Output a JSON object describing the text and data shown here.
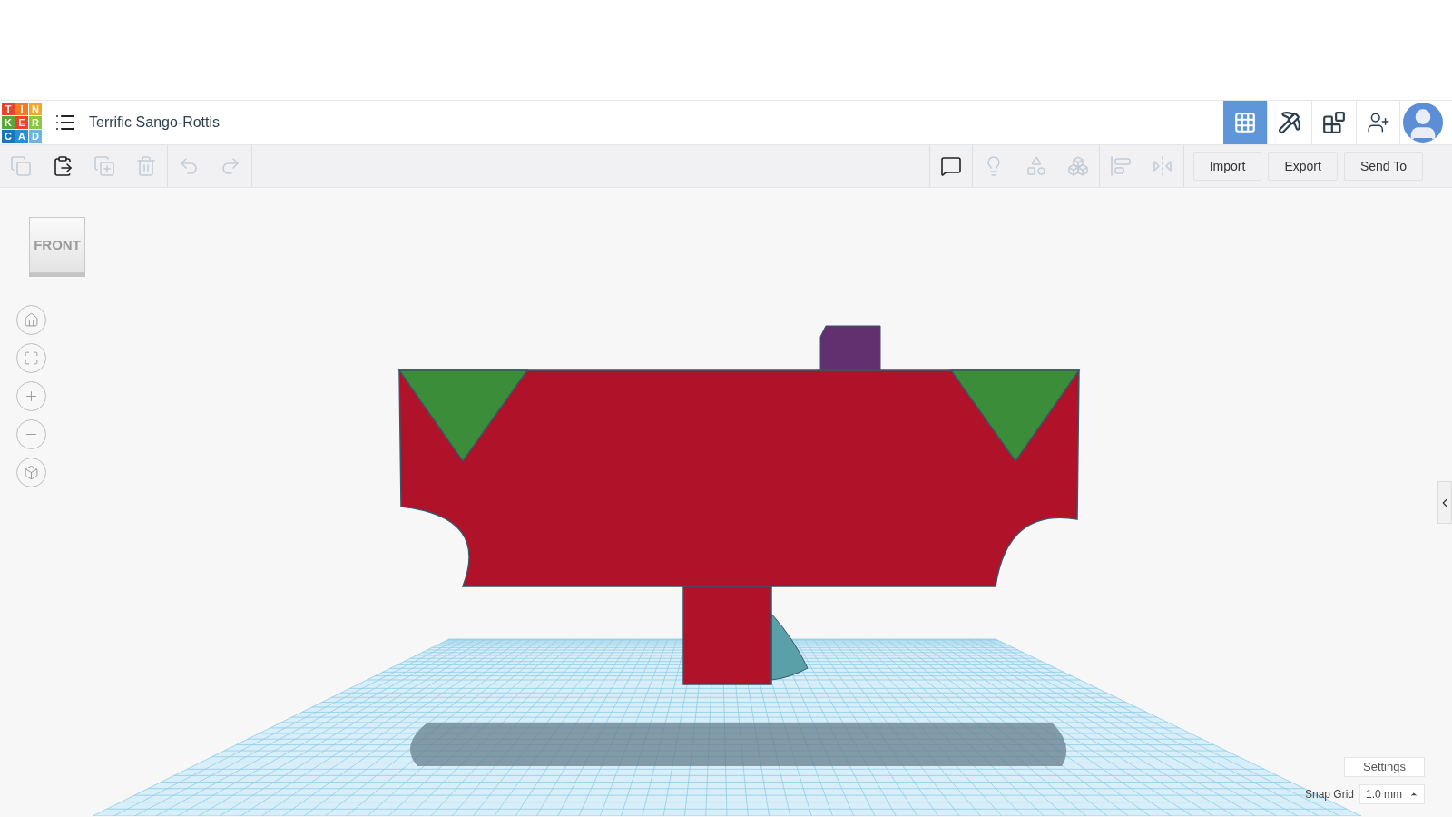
{
  "logo": [
    {
      "letter": "T",
      "color": "#e8452c"
    },
    {
      "letter": "I",
      "color": "#f47b20"
    },
    {
      "letter": "N",
      "color": "#f5a623"
    },
    {
      "letter": "K",
      "color": "#58a737"
    },
    {
      "letter": "E",
      "color": "#e8452c"
    },
    {
      "letter": "R",
      "color": "#8dc63f"
    },
    {
      "letter": "C",
      "color": "#1a75bb"
    },
    {
      "letter": "A",
      "color": "#2a8fd4"
    },
    {
      "letter": "D",
      "color": "#6cb4e4"
    }
  ],
  "design_title": "Terrific Sango-Rottis",
  "header_nav": [
    {
      "kind": "grid",
      "selected": true
    },
    {
      "kind": "pickaxe",
      "selected": false
    },
    {
      "kind": "brick",
      "selected": false
    }
  ],
  "toolbar_left": [
    {
      "kind": "copy",
      "disabled": true
    },
    {
      "kind": "paste",
      "disabled": false
    },
    {
      "kind": "duplicate",
      "disabled": true
    },
    {
      "kind": "delete",
      "disabled": true
    },
    {
      "kind": "undo",
      "disabled": true
    },
    {
      "kind": "redo",
      "disabled": true
    }
  ],
  "toolbar_right": [
    {
      "kind": "notes",
      "disabled": false
    },
    {
      "kind": "light",
      "disabled": true
    },
    {
      "kind": "group",
      "disabled": true
    },
    {
      "kind": "ungroup",
      "disabled": true
    },
    {
      "kind": "align",
      "disabled": true
    },
    {
      "kind": "mirror",
      "disabled": true
    }
  ],
  "actions": [
    "Import",
    "Export",
    "Send To"
  ],
  "view_cube": "FRONT",
  "settings_button": "Settings",
  "snap_grid": {
    "label": "Snap Grid",
    "value": "1.0 mm"
  }
}
